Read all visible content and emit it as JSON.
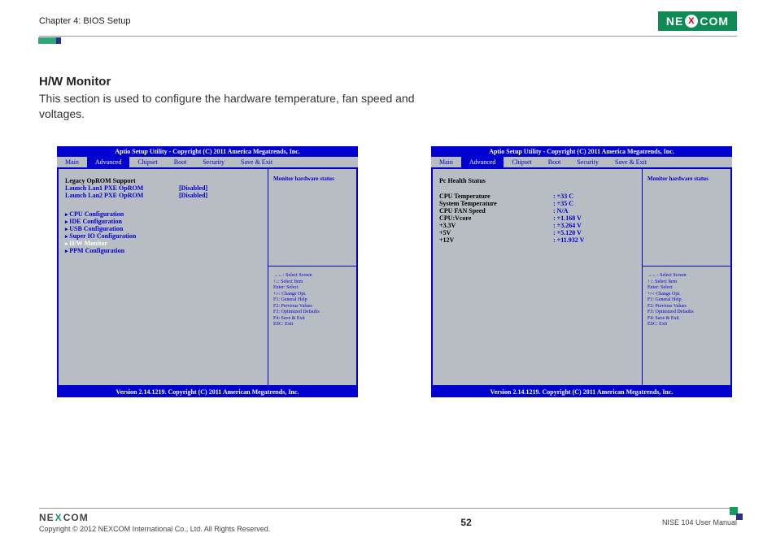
{
  "header": {
    "chapter": "Chapter 4: BIOS Setup",
    "brand_pre": "NE",
    "brand_x": "X",
    "brand_post": "COM"
  },
  "section": {
    "title": "H/W Monitor",
    "desc": "This section is used to configure the hardware temperature, fan speed and voltages."
  },
  "bios": {
    "title": "Aptio Setup Utility - Copyright (C) 2011 America Megatrends, Inc.",
    "footer": "Version 2.14.1219. Copyright (C) 2011 American Megatrends, Inc.",
    "tabs": [
      "Main",
      "Advanced",
      "Chipset",
      "Boot",
      "Security",
      "Save & Exit"
    ],
    "help": "Monitor hardware status",
    "keys": [
      "→←: Select Screen",
      "↑↓: Select Item",
      "Enter: Select",
      "+/-: Change Opt.",
      "F1: General Help",
      "F2: Previous Values",
      "F3: Optimized Defaults",
      "F4: Save & Exit",
      "ESC: Exit"
    ]
  },
  "left_panel": {
    "legacy_header": "Legacy OpROM Support",
    "lan1_label": "Launch Lan1 PXE OpROM",
    "lan1_value": "[Disabled]",
    "lan2_label": "Launch Lan2 PXE OpROM",
    "lan2_value": "[Disabled]",
    "menu": [
      "CPU Configuration",
      "IDE  Configuration",
      "USB Configuration",
      "Super IO Configuration",
      "H/W Monitor",
      "PPM Configuration"
    ]
  },
  "right_panel": {
    "header": "Pc Health Status",
    "rows": [
      {
        "label": "CPU Temperature",
        "value": ": +33 C"
      },
      {
        "label": "System Temperature",
        "value": ": +35 C"
      },
      {
        "label": "CPU FAN Speed",
        "value": ": N/A"
      },
      {
        "label": "CPU:Vcore",
        "value": ": +1.168 V"
      },
      {
        "label": "+3.3V",
        "value": ": +3.264 V"
      },
      {
        "label": "+5V",
        "value": ": +5.120 V"
      },
      {
        "label": "+12V",
        "value": ": +11.932 V"
      }
    ]
  },
  "footer": {
    "copyright": "Copyright © 2012 NEXCOM International Co., Ltd. All Rights Reserved.",
    "page": "52",
    "manual": "NISE 104 User Manual",
    "brand_pre": "NE",
    "brand_x": "X",
    "brand_post": "COM"
  }
}
